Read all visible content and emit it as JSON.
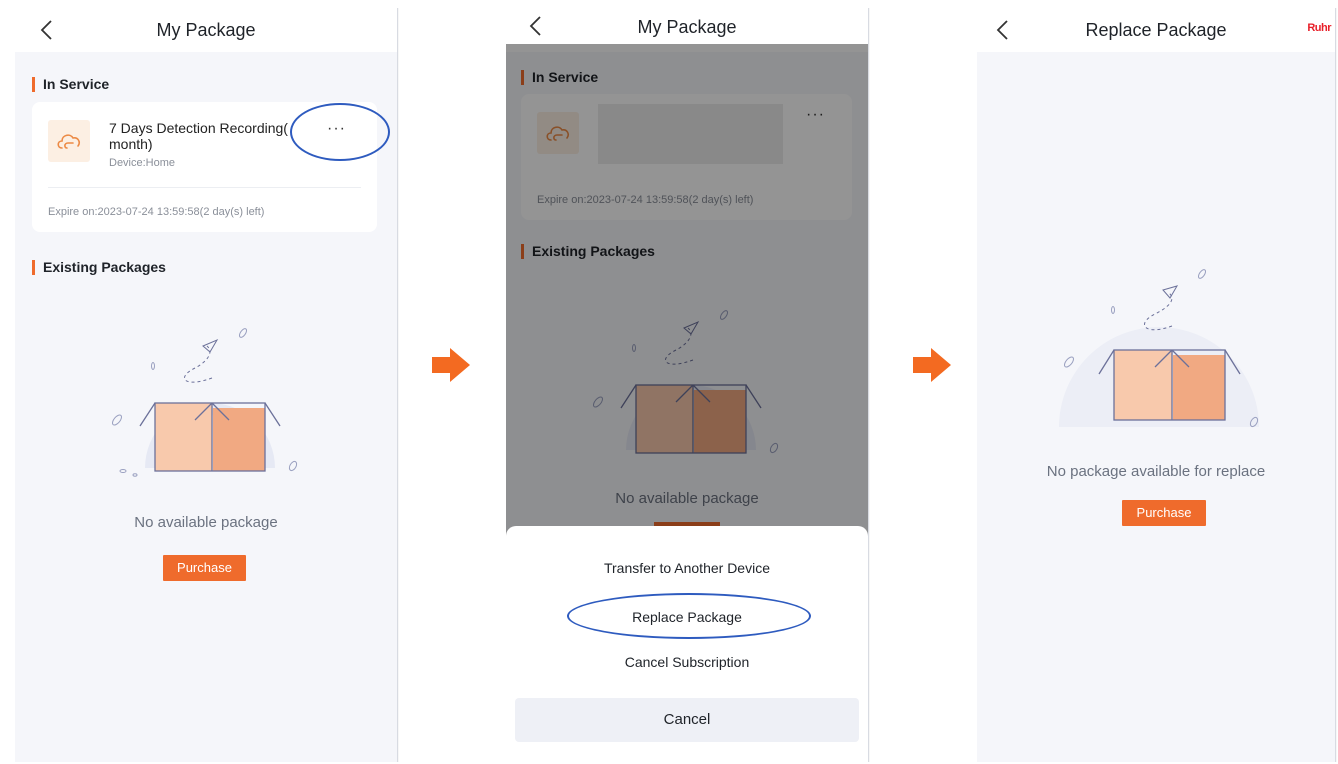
{
  "colors": {
    "accent": "#ef6b2c",
    "highlight": "#2e5bbf",
    "arrow": "#f36a21",
    "background": "#f5f6fa"
  },
  "screen1": {
    "header": {
      "title": "My Package",
      "back_icon": "chevron-left-icon"
    },
    "in_service": {
      "label": "In Service",
      "package": {
        "name": "7 Days Detection Recording(",
        "name_line2": "month)",
        "device": "Device:Home",
        "expire": "Expire on:2023-07-24 13:59:58(2 day(s) left)",
        "icon": "cloud-icon",
        "more_icon": "more-dots-icon",
        "more_label": "···"
      }
    },
    "existing": {
      "label": "Existing Packages",
      "empty_text": "No available package",
      "purchase_label": "Purchase"
    }
  },
  "screen2": {
    "header": {
      "title": "My Package",
      "back_icon": "chevron-left-icon"
    },
    "in_service": {
      "label": "In Service",
      "more_label": "···",
      "expire": "Expire on:2023-07-24 13:59:58(2 day(s) left)"
    },
    "existing": {
      "label": "Existing Packages",
      "empty_text": "No available package"
    },
    "sheet": {
      "items": [
        "Transfer to Another Device",
        "Replace Package",
        "Cancel Subscription"
      ],
      "cancel_label": "Cancel"
    }
  },
  "screen3": {
    "header": {
      "title": "Replace Package",
      "back_icon": "chevron-left-icon",
      "logo": "Ruhr"
    },
    "empty_text": "No package available for replace",
    "purchase_label": "Purchase"
  },
  "arrows": [
    "arrow-right-icon",
    "arrow-right-icon"
  ]
}
